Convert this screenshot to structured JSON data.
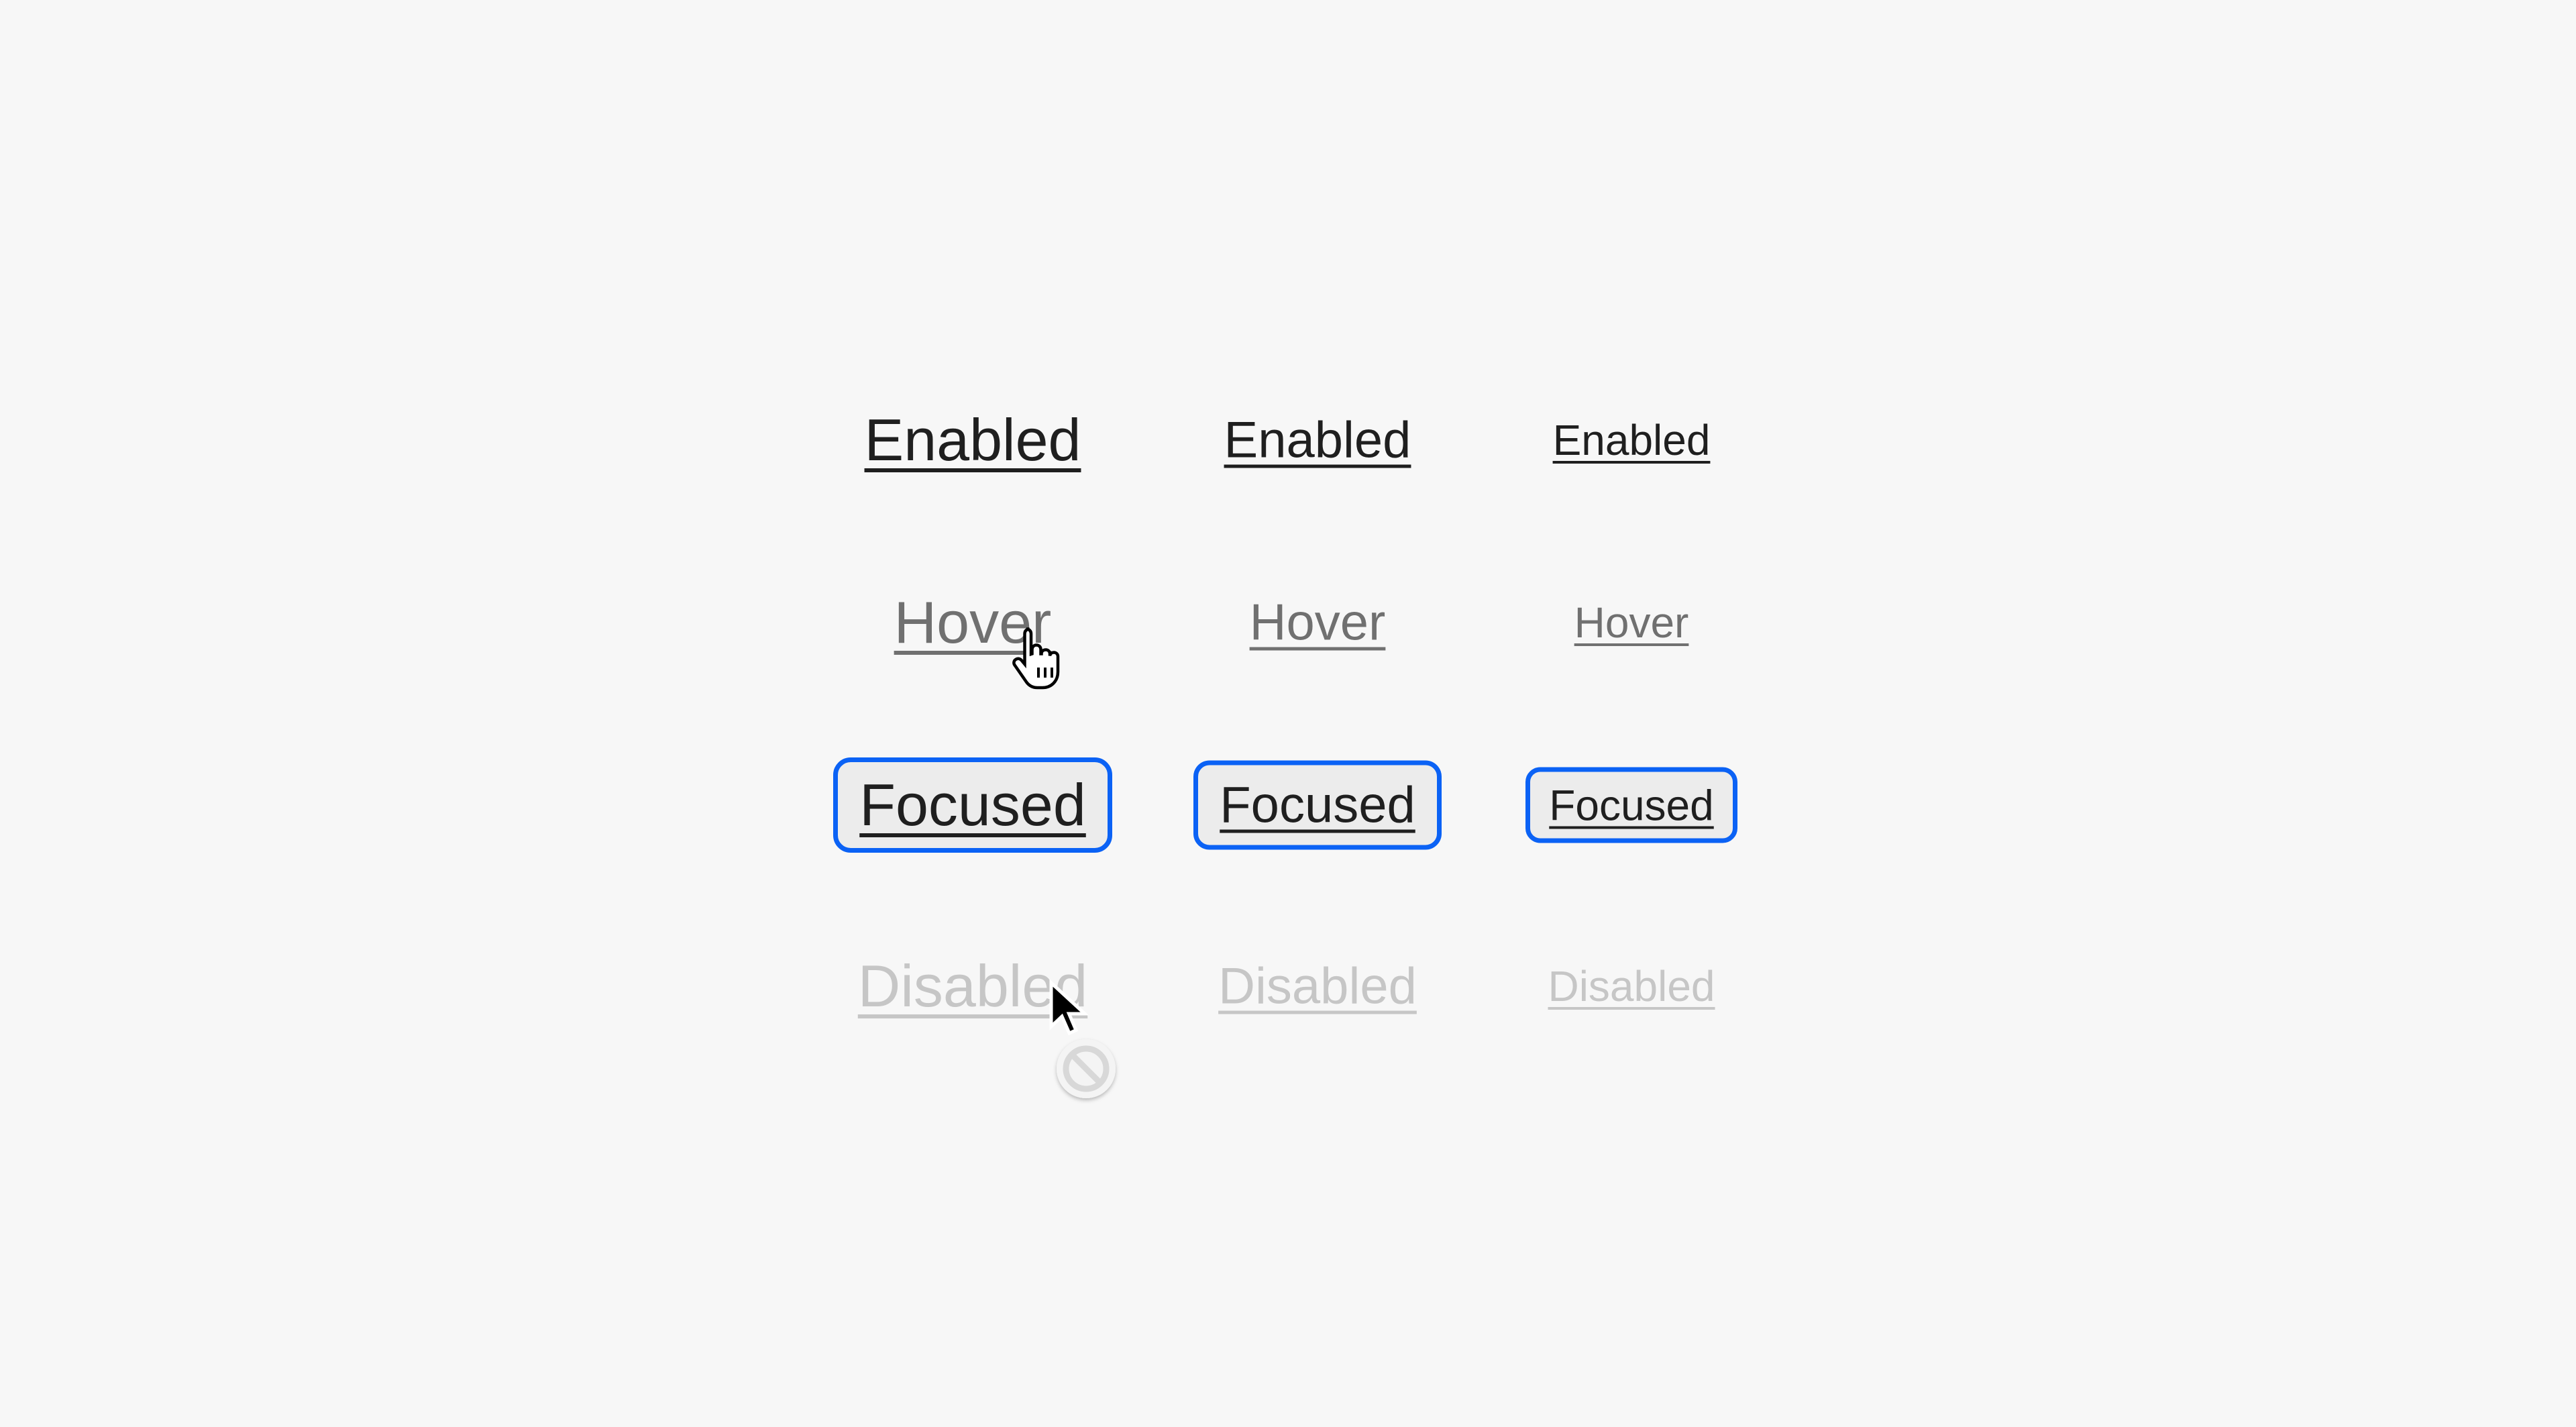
{
  "colors": {
    "background": "#f7f7f7",
    "enabled": "#1f1f1f",
    "hover": "#707070",
    "disabled": "#c6c6c6",
    "focus_ring": "#0b62f5",
    "focus_fill": "#ececec"
  },
  "rows": [
    {
      "state": "enabled",
      "labels": [
        "Enabled",
        "Enabled",
        "Enabled"
      ]
    },
    {
      "state": "hover",
      "labels": [
        "Hover",
        "Hover",
        "Hover"
      ]
    },
    {
      "state": "focused",
      "labels": [
        "Focused",
        "Focused",
        "Focused"
      ]
    },
    {
      "state": "disabled",
      "labels": [
        "Disabled",
        "Disabled",
        "Disabled"
      ]
    }
  ],
  "cursors": [
    "pointer-hand-icon",
    "arrow-cursor-icon",
    "not-allowed-icon"
  ]
}
